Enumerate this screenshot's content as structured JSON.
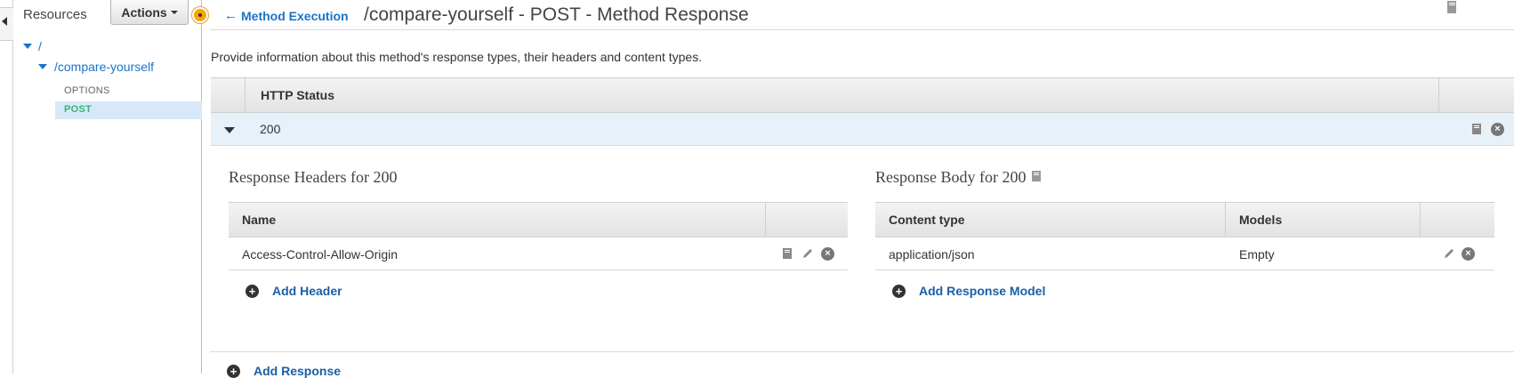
{
  "sidebar": {
    "title": "Resources",
    "actions_label": "Actions",
    "tree": {
      "root": "/",
      "resource": "/compare-yourself",
      "methods": [
        "OPTIONS",
        "POST"
      ]
    }
  },
  "header": {
    "back_label": "Method Execution",
    "title": "/compare-yourself - POST - Method Response"
  },
  "description": "Provide information about this method's response types, their headers and content types.",
  "status_table": {
    "header": "HTTP Status",
    "rows": [
      {
        "code": "200"
      }
    ]
  },
  "response_headers": {
    "title": "Response Headers for 200",
    "col_name": "Name",
    "rows": [
      {
        "name": "Access-Control-Allow-Origin"
      }
    ],
    "add_label": "Add Header"
  },
  "response_body": {
    "title": "Response Body for 200",
    "col_content_type": "Content type",
    "col_models": "Models",
    "rows": [
      {
        "content_type": "application/json",
        "model": "Empty"
      }
    ],
    "add_label": "Add Response Model"
  },
  "add_response_label": "Add Response",
  "icons": [
    "collapse-panel-icon",
    "book-icon",
    "pencil-icon",
    "remove-icon",
    "add-icon",
    "back-arrow-icon",
    "caret-down-icon"
  ],
  "colors": {
    "link": "#1a73c8",
    "selected_row": "#d7e9f8",
    "post_method": "#3cb371",
    "status_row": "#e6f1fa"
  }
}
